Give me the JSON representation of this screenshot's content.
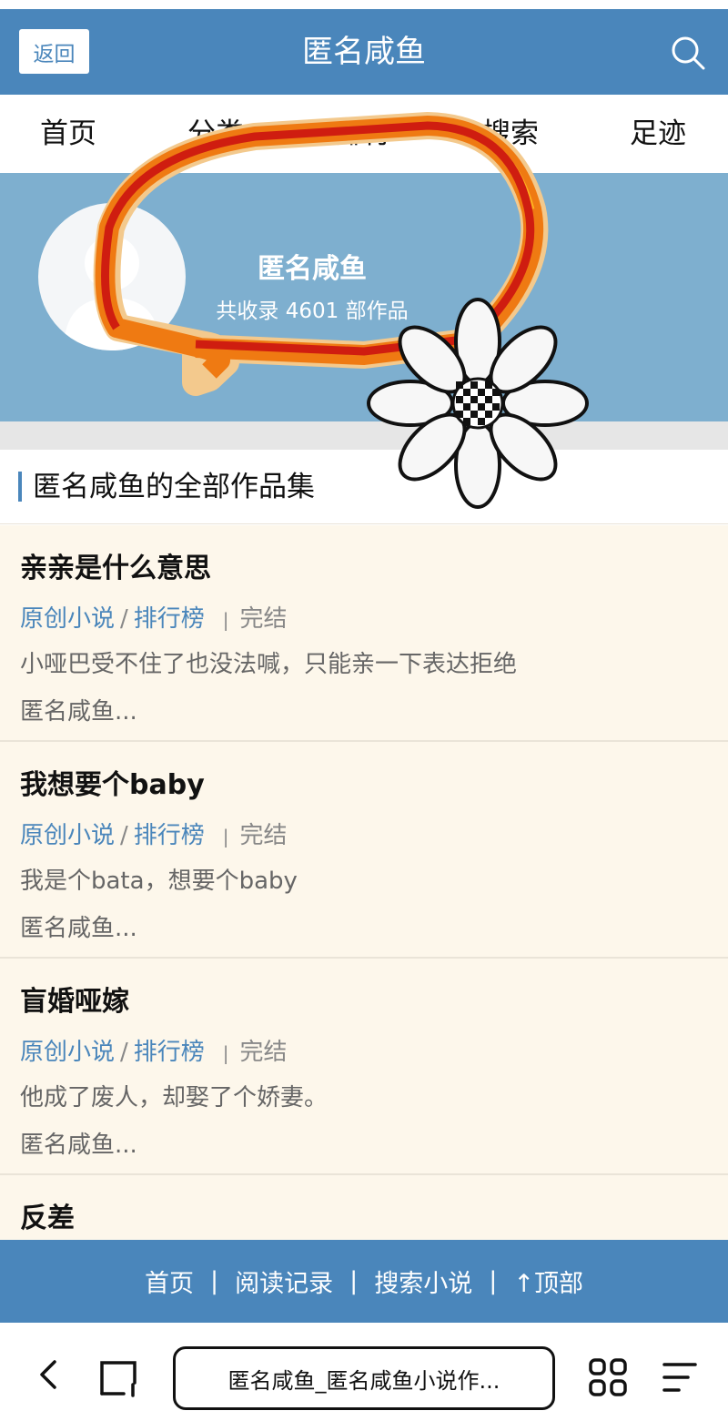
{
  "header": {
    "back_label": "返回",
    "title": "匿名咸鱼"
  },
  "nav": {
    "items": [
      "首页",
      "分类",
      "排行",
      "搜索",
      "足迹"
    ]
  },
  "profile": {
    "name": "匿名咸鱼",
    "count_text": "共收录 4601 部作品"
  },
  "section": {
    "title": "匿名咸鱼的全部作品集"
  },
  "books": [
    {
      "title": "亲亲是什么意思",
      "category": "原创小说",
      "rank": "排行榜",
      "status": "完结",
      "desc": "小哑巴受不住了也没法喊，只能亲一下表达拒绝",
      "author": "匿名咸鱼..."
    },
    {
      "title": "我想要个baby",
      "category": "原创小说",
      "rank": "排行榜",
      "status": "完结",
      "desc": "我是个bata，想要个baby",
      "author": "匿名咸鱼..."
    },
    {
      "title": "盲婚哑嫁",
      "category": "原创小说",
      "rank": "排行榜",
      "status": "完结",
      "desc": "他成了废人，却娶了个娇妻。",
      "author": "匿名咸鱼..."
    },
    {
      "title": "反差",
      "category": "",
      "rank": "",
      "status": "",
      "desc": "",
      "author": ""
    }
  ],
  "footer": {
    "home": "首页",
    "history": "阅读记录",
    "search": "搜索小说",
    "top": "↑顶部"
  },
  "browser": {
    "url_text": "匿名咸鱼_匿名咸鱼小说作..."
  },
  "colors": {
    "accent": "#4a86bb",
    "profile_bg": "#7eafcf",
    "list_bg": "#fdf7eb"
  }
}
